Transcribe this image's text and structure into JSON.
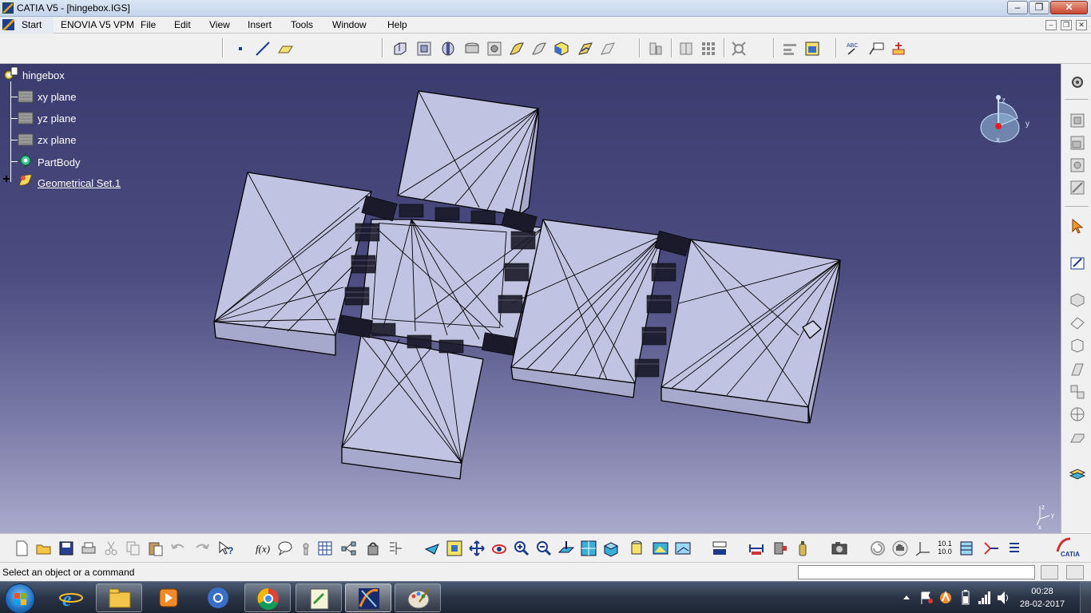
{
  "window": {
    "title": "CATIA V5 - [hingebox.IGS]",
    "minimize": "–",
    "restore": "❐",
    "close": "✕"
  },
  "menu": {
    "items": [
      "Start",
      "ENOVIA V5 VPM",
      "File",
      "Edit",
      "View",
      "Insert",
      "Tools",
      "Window",
      "Help"
    ],
    "mdi": [
      "–",
      "❐",
      "✕"
    ]
  },
  "tree": {
    "root": "hingebox",
    "nodes": [
      {
        "label": "xy plane",
        "icon": "plane-icon"
      },
      {
        "label": "yz plane",
        "icon": "plane-icon"
      },
      {
        "label": "zx plane",
        "icon": "plane-icon"
      },
      {
        "label": "PartBody",
        "icon": "partbody-gear-icon"
      },
      {
        "label": "Geometrical Set.1",
        "icon": "geometrical-set-icon",
        "expandable": true
      }
    ]
  },
  "compass": {
    "x": "x",
    "y": "y",
    "z": "z"
  },
  "mini_axis": {
    "x": "x",
    "y": "y",
    "z": "z"
  },
  "toolbar_top": {
    "icons": [
      "point-icon",
      "line-icon",
      "plane-icon",
      "pad-icon",
      "pocket-icon",
      "shaft-icon",
      "groove-icon",
      "hole-icon",
      "rib-icon",
      "slot-icon",
      "stiffener-icon",
      "solid-combine-icon",
      "multi-section-icon",
      "dress-up-icon",
      "thickness-icon",
      "pattern-icon",
      "boolean-icon",
      "axis-system-icon",
      "analysis-icon",
      "table-icon",
      "catalog-icon",
      "text-annotation-icon",
      "flag-note-icon",
      "measure-icon"
    ]
  },
  "toolbar_right": {
    "icons": [
      "sketcher-gear-icon",
      "sketch-icon-1",
      "sketch-icon-2",
      "sketch-icon-3",
      "sketch-icon-4",
      "select-arrow-icon",
      "sketch-positioned-icon",
      "pad-3d-icon",
      "surface-icon",
      "solid-icon",
      "draft-icon",
      "pattern-3d-icon",
      "sphere-icon",
      "chamfer-icon",
      "apply-material-icon"
    ]
  },
  "toolbar_bottom": {
    "icons": [
      "new-icon",
      "open-icon",
      "save-icon",
      "print-icon",
      "cut-icon",
      "copy-icon",
      "paste-icon",
      "undo-icon",
      "redo-icon",
      "whats-this-icon",
      "formula-icon",
      "knowledge-icon",
      "parameter-icon",
      "design-table-icon",
      "tree-reorder-icon",
      "scan-icon",
      "parent-children-icon",
      "fly-mode-icon",
      "fit-all-icon",
      "pan-icon",
      "rotate-icon",
      "zoom-in-icon",
      "zoom-out-icon",
      "normal-view-icon",
      "multi-view-icon",
      "iso-view-icon",
      "shading-icon",
      "render-icon",
      "hide-show-icon",
      "swap-visible-icon",
      "measure-between-icon",
      "measure-item-icon",
      "measure-inertia-icon",
      "capture-icon",
      "update-icon",
      "grab-icon",
      "axis-icon",
      "snap-grid-icon",
      "layer-icon",
      "constraint-icon",
      "list-icon"
    ],
    "grid_label_top": "10.1",
    "grid_label_bottom": "10.0"
  },
  "status": {
    "message": "Select an object or a command",
    "command_value": "",
    "command_placeholder": ""
  },
  "taskbar": {
    "apps": [
      {
        "name": "internet-explorer-icon",
        "state": "pinned"
      },
      {
        "name": "file-explorer-icon",
        "state": "running"
      },
      {
        "name": "media-player-icon",
        "state": "pinned"
      },
      {
        "name": "chrome-canary-icon",
        "state": "pinned"
      },
      {
        "name": "chrome-icon",
        "state": "running"
      },
      {
        "name": "notepad-plus-icon",
        "state": "running"
      },
      {
        "name": "catia-icon",
        "state": "active"
      },
      {
        "name": "paint-icon",
        "state": "running"
      }
    ],
    "tray_icons": [
      "show-hidden-icons-arrow",
      "flag-icon",
      "avast-icon",
      "battery-icon",
      "network-icon",
      "speaker-icon"
    ],
    "time": "00:28",
    "date": "28-02-2017"
  },
  "colors": {
    "background_top": "#3b3c6e",
    "background_bottom": "#a9aacb",
    "model_face": "#c0c3e2",
    "model_side": "#a6a9cc",
    "edge": "#000000"
  }
}
